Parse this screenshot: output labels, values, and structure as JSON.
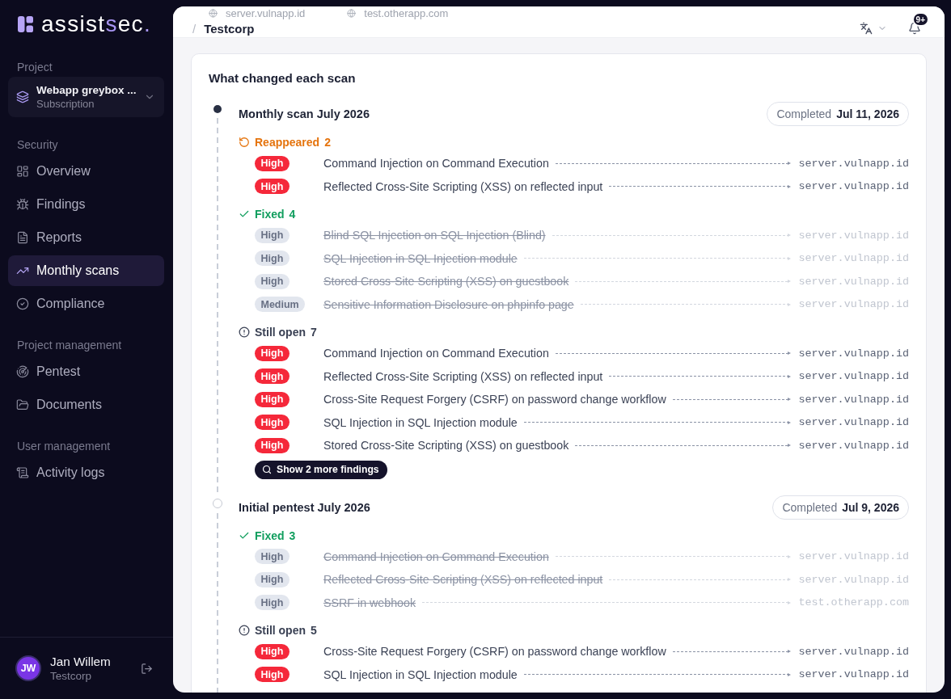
{
  "sidebar": {
    "logo": {
      "parts": [
        {
          "text": "assist",
          "accent": false
        },
        {
          "text": "s",
          "accent": true
        },
        {
          "text": "ec",
          "accent": false
        },
        {
          "text": ".",
          "accent": true
        }
      ]
    },
    "project": {
      "label": "Project",
      "name": "Webapp greybox ...",
      "plan": "Subscription"
    },
    "sections": [
      {
        "title": "Security",
        "items": [
          {
            "label": "Overview",
            "selected": false
          },
          {
            "label": "Findings",
            "selected": false
          },
          {
            "label": "Reports",
            "selected": false
          },
          {
            "label": "Monthly scans",
            "selected": true
          },
          {
            "label": "Compliance",
            "selected": false
          }
        ]
      },
      {
        "title": "Project management",
        "items": [
          {
            "label": "Pentest",
            "selected": false
          },
          {
            "label": "Documents",
            "selected": false
          }
        ]
      },
      {
        "title": "User management",
        "items": [
          {
            "label": "Activity logs",
            "selected": false
          }
        ]
      }
    ],
    "user": {
      "initials": "JW",
      "name": "Jan Willem",
      "org": "Testcorp"
    }
  },
  "header": {
    "underlay": [
      "server.vulnapp.id",
      "test.otherapp.com"
    ],
    "breadcrumb": {
      "separator": "/",
      "label": "Testcorp"
    },
    "notifications": "9+"
  },
  "card": {
    "title": "What changed each scan",
    "scans": [
      {
        "title": "Monthly scan July 2026",
        "current": true,
        "status": "Completed",
        "date": "Jul 11, 2026",
        "groups": [
          {
            "kind": "reappeared",
            "label": "Reappeared",
            "count": "2",
            "findings": [
              {
                "severity": "High",
                "title": "Command Injection on Command Execution",
                "host": "server.vulnapp.id"
              },
              {
                "severity": "High",
                "title": "Reflected Cross-Site Scripting (XSS) on reflected input",
                "host": "server.vulnapp.id"
              }
            ]
          },
          {
            "kind": "fixed",
            "label": "Fixed",
            "count": "4",
            "findings": [
              {
                "severity": "High",
                "title": "Blind SQL Injection on SQL Injection (Blind)",
                "host": "server.vulnapp.id"
              },
              {
                "severity": "High",
                "title": "SQL Injection in SQL Injection module",
                "host": "server.vulnapp.id"
              },
              {
                "severity": "High",
                "title": "Stored Cross-Site Scripting (XSS) on guestbook",
                "host": "server.vulnapp.id"
              },
              {
                "severity": "Medium",
                "title": "Sensitive Information Disclosure on phpinfo page",
                "host": "server.vulnapp.id"
              }
            ]
          },
          {
            "kind": "still_open",
            "label": "Still open",
            "count": "7",
            "findings": [
              {
                "severity": "High",
                "title": "Command Injection on Command Execution",
                "host": "server.vulnapp.id"
              },
              {
                "severity": "High",
                "title": "Reflected Cross-Site Scripting (XSS) on reflected input",
                "host": "server.vulnapp.id"
              },
              {
                "severity": "High",
                "title": "Cross-Site Request Forgery (CSRF) on password change workflow",
                "host": "server.vulnapp.id"
              },
              {
                "severity": "High",
                "title": "SQL Injection in SQL Injection module",
                "host": "server.vulnapp.id"
              },
              {
                "severity": "High",
                "title": "Stored Cross-Site Scripting (XSS) on guestbook",
                "host": "server.vulnapp.id"
              }
            ]
          }
        ],
        "more_button": "Show 2 more findings"
      },
      {
        "title": "Initial pentest July 2026",
        "current": false,
        "status": "Completed",
        "date": "Jul 9, 2026",
        "groups": [
          {
            "kind": "fixed",
            "label": "Fixed",
            "count": "3",
            "findings": [
              {
                "severity": "High",
                "title": "Command Injection on Command Execution",
                "host": "server.vulnapp.id"
              },
              {
                "severity": "High",
                "title": "Reflected Cross-Site Scripting (XSS) on reflected input",
                "host": "server.vulnapp.id"
              },
              {
                "severity": "High",
                "title": "SSRF in webhook",
                "host": "test.otherapp.com"
              }
            ]
          },
          {
            "kind": "still_open",
            "label": "Still open",
            "count": "5",
            "findings": [
              {
                "severity": "High",
                "title": "Cross-Site Request Forgery (CSRF) on password change workflow",
                "host": "server.vulnapp.id"
              },
              {
                "severity": "High",
                "title": "SQL Injection in SQL Injection module",
                "host": "server.vulnapp.id"
              }
            ]
          }
        ]
      }
    ]
  }
}
